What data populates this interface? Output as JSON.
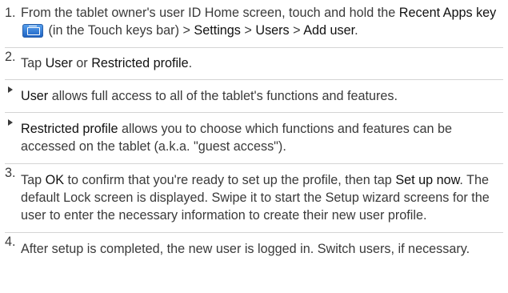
{
  "steps": {
    "s1": {
      "num": "1.",
      "t1": "From the tablet owner's user ID Home screen, touch and hold the",
      "recent_apps_key": "Recent Apps key",
      "t2": "(in the Touch keys bar) >",
      "settings": "Settings",
      "gt1": ">",
      "users": "Users",
      "gt2": ">",
      "add_user": "Add user",
      "end": "."
    },
    "s2": {
      "num": "2.",
      "t1": "Tap",
      "user": "User",
      "or": "or",
      "restricted": "Restricted profile",
      "end": "."
    },
    "b1": {
      "user": "User",
      "text": "allows full access to all of the tablet's functions and features."
    },
    "b2": {
      "restricted": "Restricted profile",
      "text": "allows you to choose which functions and features can be accessed on the tablet (a.k.a. \"guest access\")."
    },
    "s3": {
      "num": "3.",
      "t1": "Tap",
      "ok": "OK",
      "t2": "to confirm that you're ready to set up the profile, then tap",
      "setup_now": "Set up now",
      "t3": ". The default Lock screen is displayed. Swipe it to start the Setup wizard screens for the user to enter the necessary information to create their new user profile."
    },
    "s4": {
      "num": "4.",
      "text": "After setup is completed, the new user is logged in. Switch users, if necessary."
    }
  },
  "icons": {
    "recent_apps_key_icon": "recent-apps-key-icon"
  },
  "colors": {
    "text": "#3a3a3a",
    "highlight": "#111111",
    "separator": "#d4d4d4",
    "key_icon_blue": "#1a5fc0"
  }
}
